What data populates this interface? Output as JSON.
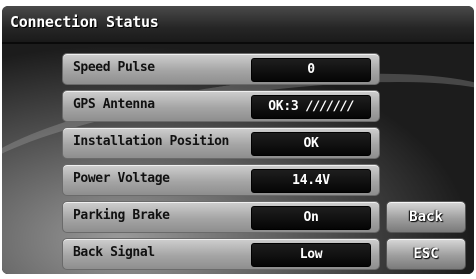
{
  "window": {
    "title": "Connection Status"
  },
  "rows": [
    {
      "label": "Speed Pulse",
      "value": "0"
    },
    {
      "label": "GPS Antenna",
      "value": "OK:3",
      "signal": "∕∕∕∕∕∕∕"
    },
    {
      "label": "Installation Position",
      "value": "OK"
    },
    {
      "label": "Power Voltage",
      "value": "14.4V"
    },
    {
      "label": "Parking Brake",
      "value": "On"
    },
    {
      "label": "Back Signal",
      "value": "Low"
    }
  ],
  "buttons": {
    "back": "Back",
    "esc": "ESC"
  }
}
